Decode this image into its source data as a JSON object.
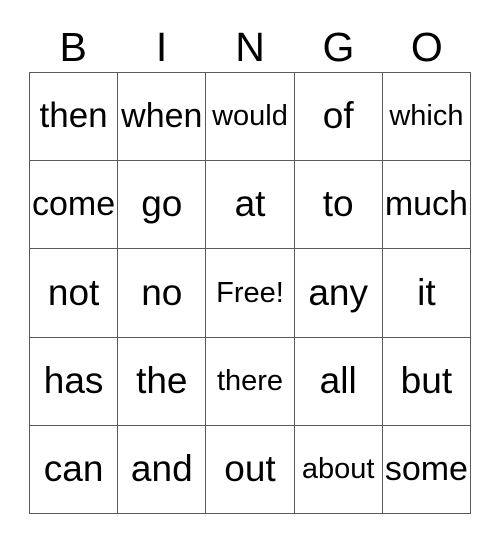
{
  "card": {
    "title": "BINGO",
    "headers": [
      "B",
      "I",
      "N",
      "G",
      "O"
    ],
    "free_space_label": "Free!",
    "colors": {
      "background": "#ffffff",
      "grid_line": "#5a5a5a",
      "text": "#000000"
    },
    "rows": [
      {
        "cells": [
          "then",
          "when",
          "would",
          "of",
          "which"
        ]
      },
      {
        "cells": [
          "come",
          "go",
          "at",
          "to",
          "much"
        ]
      },
      {
        "cells": [
          "not",
          "no",
          "Free!",
          "any",
          "it"
        ]
      },
      {
        "cells": [
          "has",
          "the",
          "there",
          "all",
          "but"
        ]
      },
      {
        "cells": [
          "can",
          "and",
          "out",
          "about",
          "some"
        ]
      }
    ]
  }
}
